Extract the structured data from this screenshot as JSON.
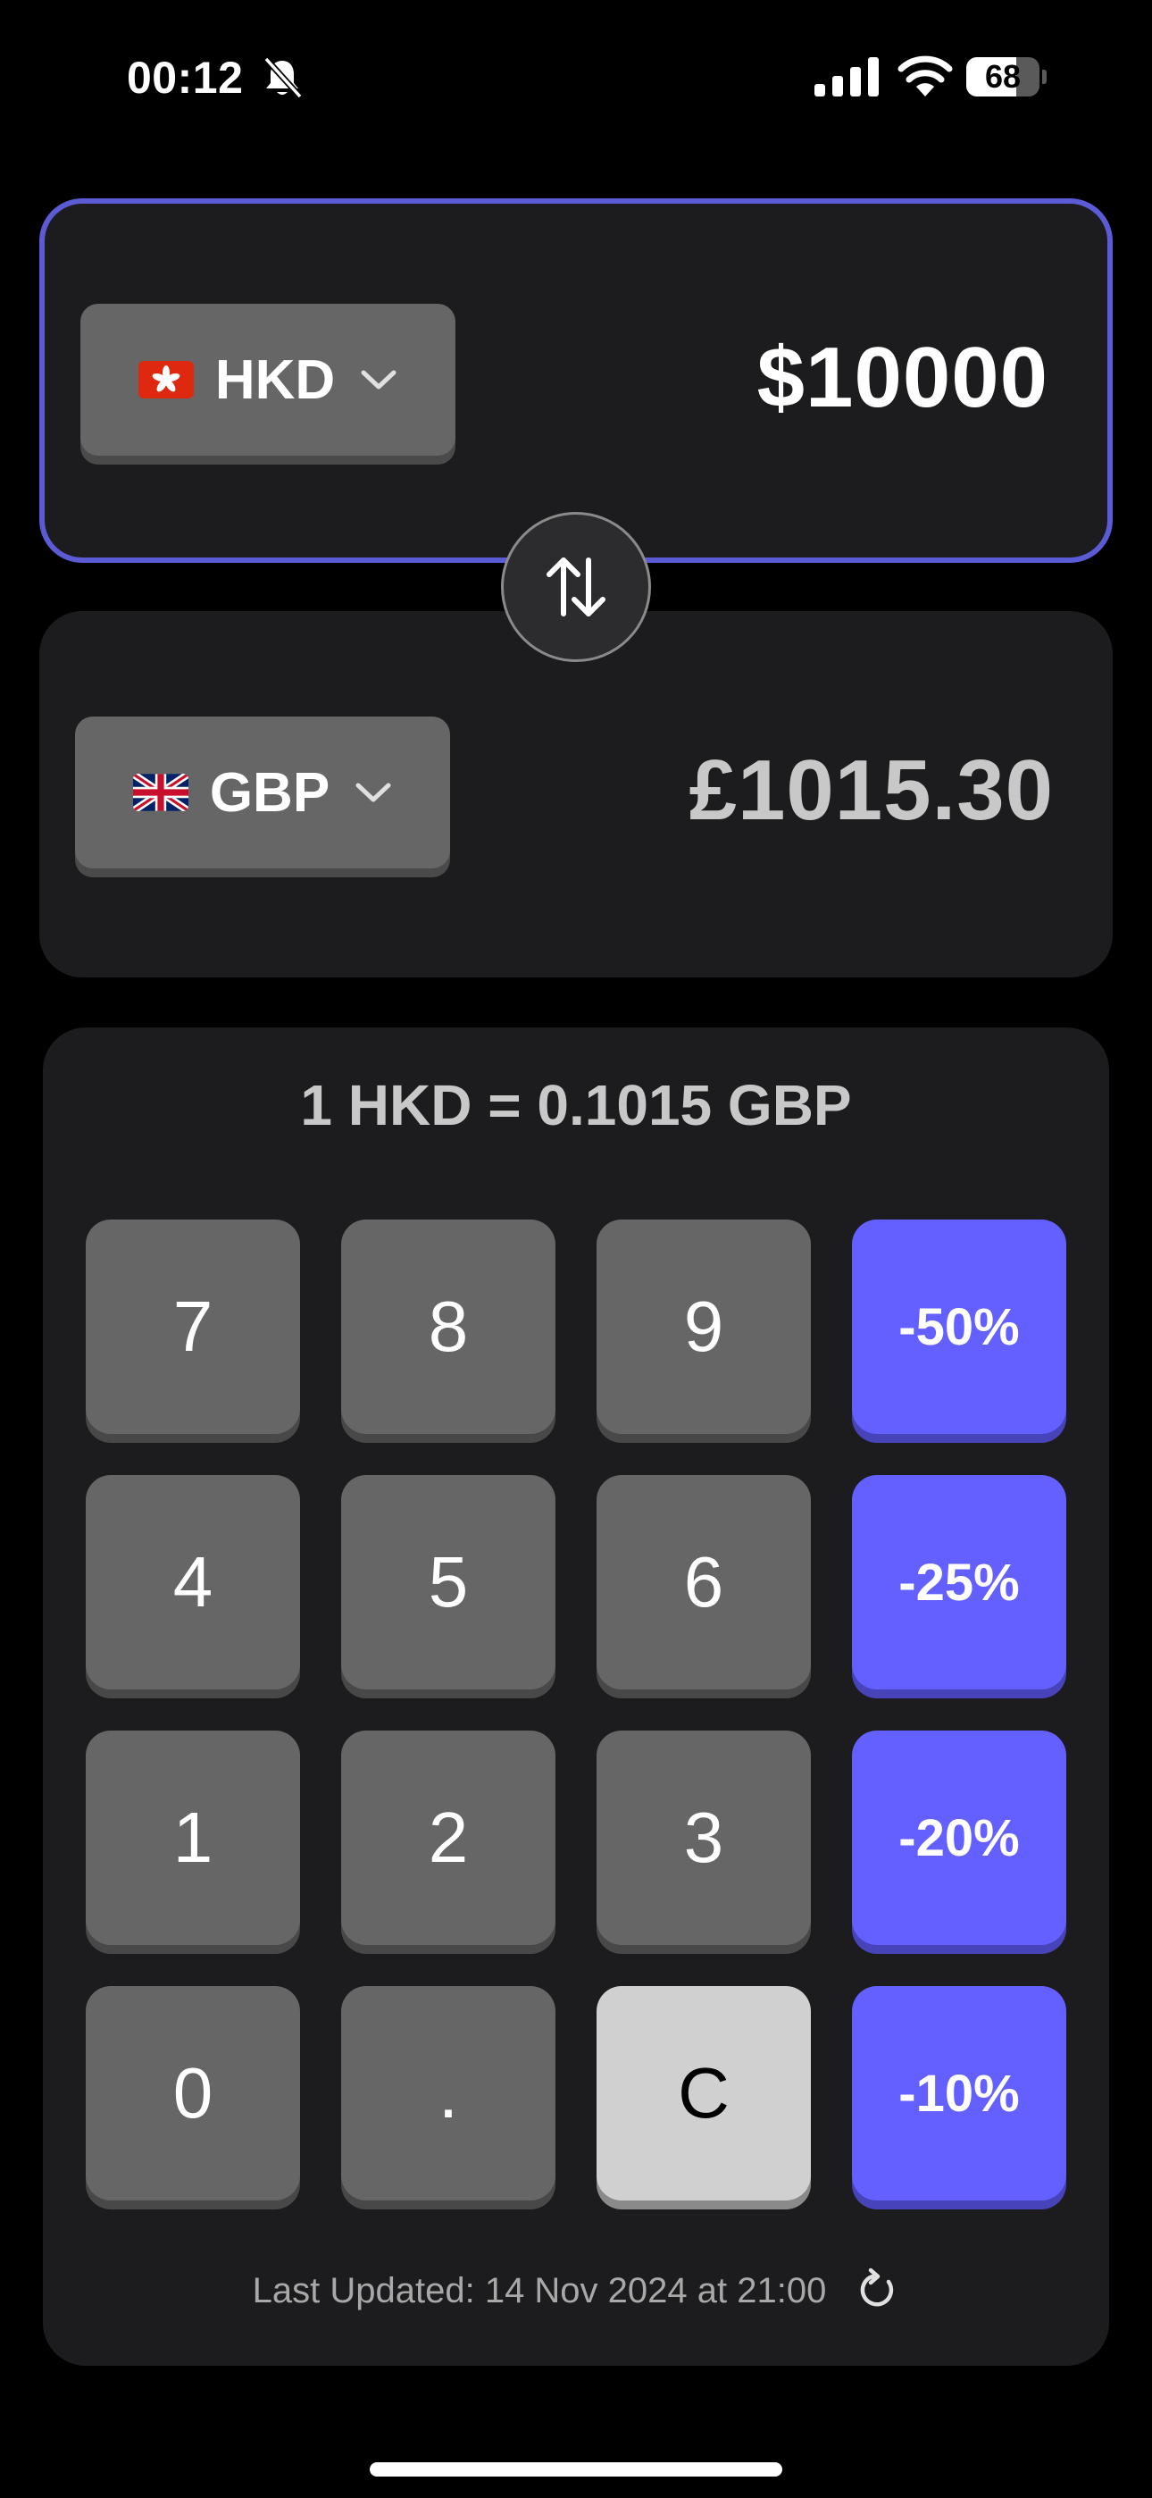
{
  "status_bar": {
    "time": "00:12",
    "battery_percent": "68",
    "battery_level": 0.68
  },
  "converter": {
    "from": {
      "code": "HKD",
      "flag_icon": "hong-kong-flag-icon",
      "amount": "$10000"
    },
    "to": {
      "code": "GBP",
      "flag_icon": "united-kingdom-flag-icon",
      "amount": "£1015.30"
    },
    "swap_icon": "swap-arrows-icon"
  },
  "rate": {
    "text": "1 HKD = 0.1015 GBP"
  },
  "keypad": {
    "rows": [
      [
        "7",
        "8",
        "9",
        "-50%"
      ],
      [
        "4",
        "5",
        "6",
        "-25%"
      ],
      [
        "1",
        "2",
        "3",
        "-20%"
      ],
      [
        "0",
        ".",
        "C",
        "-10%"
      ]
    ]
  },
  "footer": {
    "last_updated": "Last Updated: 14 Nov 2024 at 21:00"
  },
  "colors": {
    "accent": "#6360ff",
    "card_border": "#5b5bd6",
    "card_bg": "#1c1c1e",
    "key_bg": "#666666",
    "clear_key_bg": "#d0d0d0"
  }
}
